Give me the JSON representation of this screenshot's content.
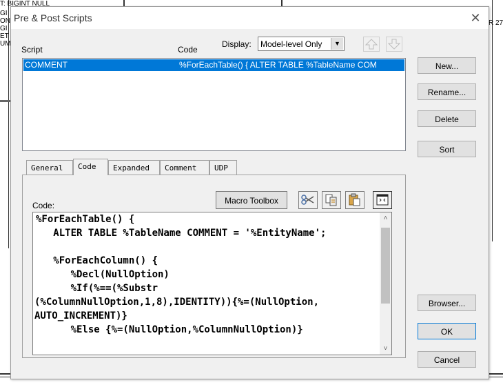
{
  "background": {
    "text_lines": [
      "T: BIGINT NULL",
      "GI",
      "ON",
      "GI",
      "ET",
      "UM"
    ],
    "side_label": "R 27"
  },
  "dialog": {
    "title": "Pre & Post Scripts",
    "close_glyph": "✕",
    "header": {
      "script_label": "Script",
      "code_label": "Code",
      "display_label": "Display:",
      "display_value": "Model-level Only"
    },
    "scripts": [
      {
        "name": "COMMENT",
        "code": "%ForEachTable() {    ALTER TABLE %TableName COM"
      }
    ],
    "buttons": {
      "new": "New...",
      "rename": "Rename...",
      "delete": "Delete",
      "sort": "Sort",
      "browser": "Browser...",
      "ok": "OK",
      "cancel": "Cancel"
    },
    "tabs": [
      {
        "label": "General"
      },
      {
        "label": "Code"
      },
      {
        "label": "Expanded"
      },
      {
        "label": "Comment"
      },
      {
        "label": "UDP"
      }
    ],
    "code_panel": {
      "label": "Code:",
      "macro_toolbox": "Macro Toolbox",
      "lines": [
        "%ForEachTable() {",
        "   ALTER TABLE %TableName COMMENT = '%EntityName';",
        "",
        "   %ForEachColumn() {",
        "      %Decl(NullOption)",
        "      %If(%==(%Substr",
        "(%ColumnNullOption,1,8),IDENTITY)){%=(NullOption,",
        "AUTO_INCREMENT)}",
        "      %Else {%=(NullOption,%ColumnNullOption)}"
      ]
    }
  }
}
